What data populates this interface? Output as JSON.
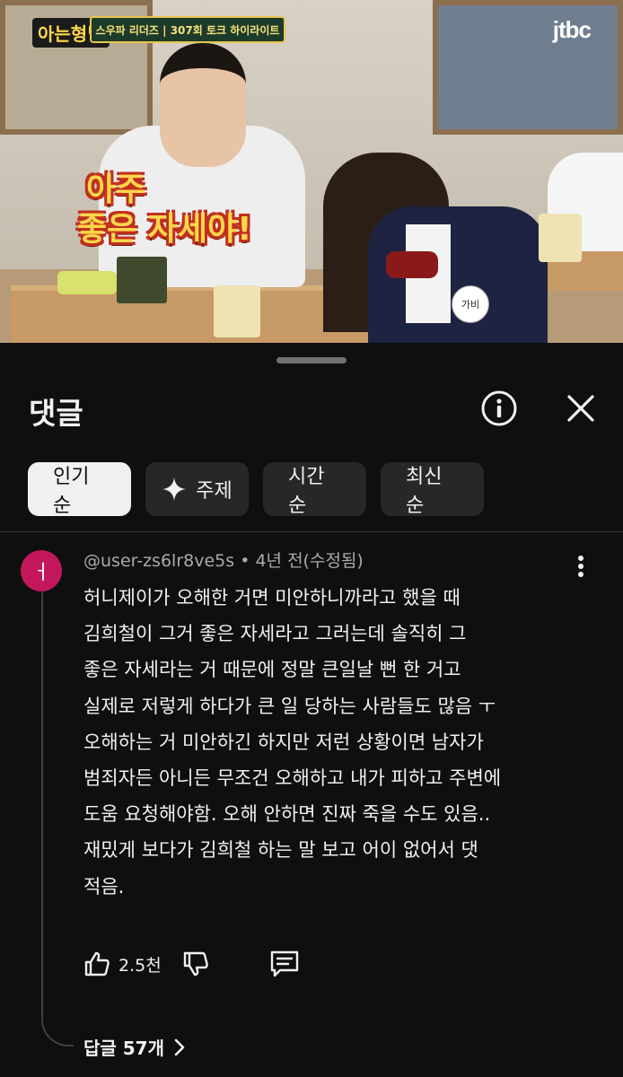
{
  "video": {
    "show_logo": "아는형님",
    "banner": "스우파 리더즈 | 307회 토크 하이라이트",
    "network_logo": "jtbc",
    "caption_line1": "아주",
    "caption_line2": "좋은 자세야!",
    "name_tag": "가비"
  },
  "panel": {
    "title": "댓글",
    "info_icon": "info-icon",
    "close_icon": "close-icon"
  },
  "sort_chips": [
    {
      "label": "인기순",
      "active": true
    },
    {
      "label": "주제",
      "icon": "sparkle-icon"
    },
    {
      "label": "시간순"
    },
    {
      "label": "최신순"
    }
  ],
  "comment": {
    "avatar_letter": "ㅓ",
    "avatar_color": "#c2185b",
    "author": "@user-zs6lr8ve5s",
    "separator": "•",
    "time": "4년 전(수정됨)",
    "lines": [
      "허니제이가 오해한 거면 미안하니까라고 했을 때",
      "김희철이 그거 좋은 자세라고 그러는데 솔직히 그",
      "좋은 자세라는 거 때문에 정말 큰일날 뻔 한 거고",
      "실제로 저렇게 하다가 큰 일 당하는 사람들도 많음 ㅜ",
      "오해하는 거 미안하긴 하지만 저런 상황이면 남자가",
      "범죄자든 아니든 무조건 오해하고 내가 피하고 주변에",
      "도움 요청해야함. 오해 안하면 진짜 죽을 수도 있음..",
      "재밌게 보다가 김희철 하는 말 보고 어이 없어서 댓",
      "적음."
    ],
    "like_count": "2.5천",
    "replies_label": "답글 57개"
  }
}
